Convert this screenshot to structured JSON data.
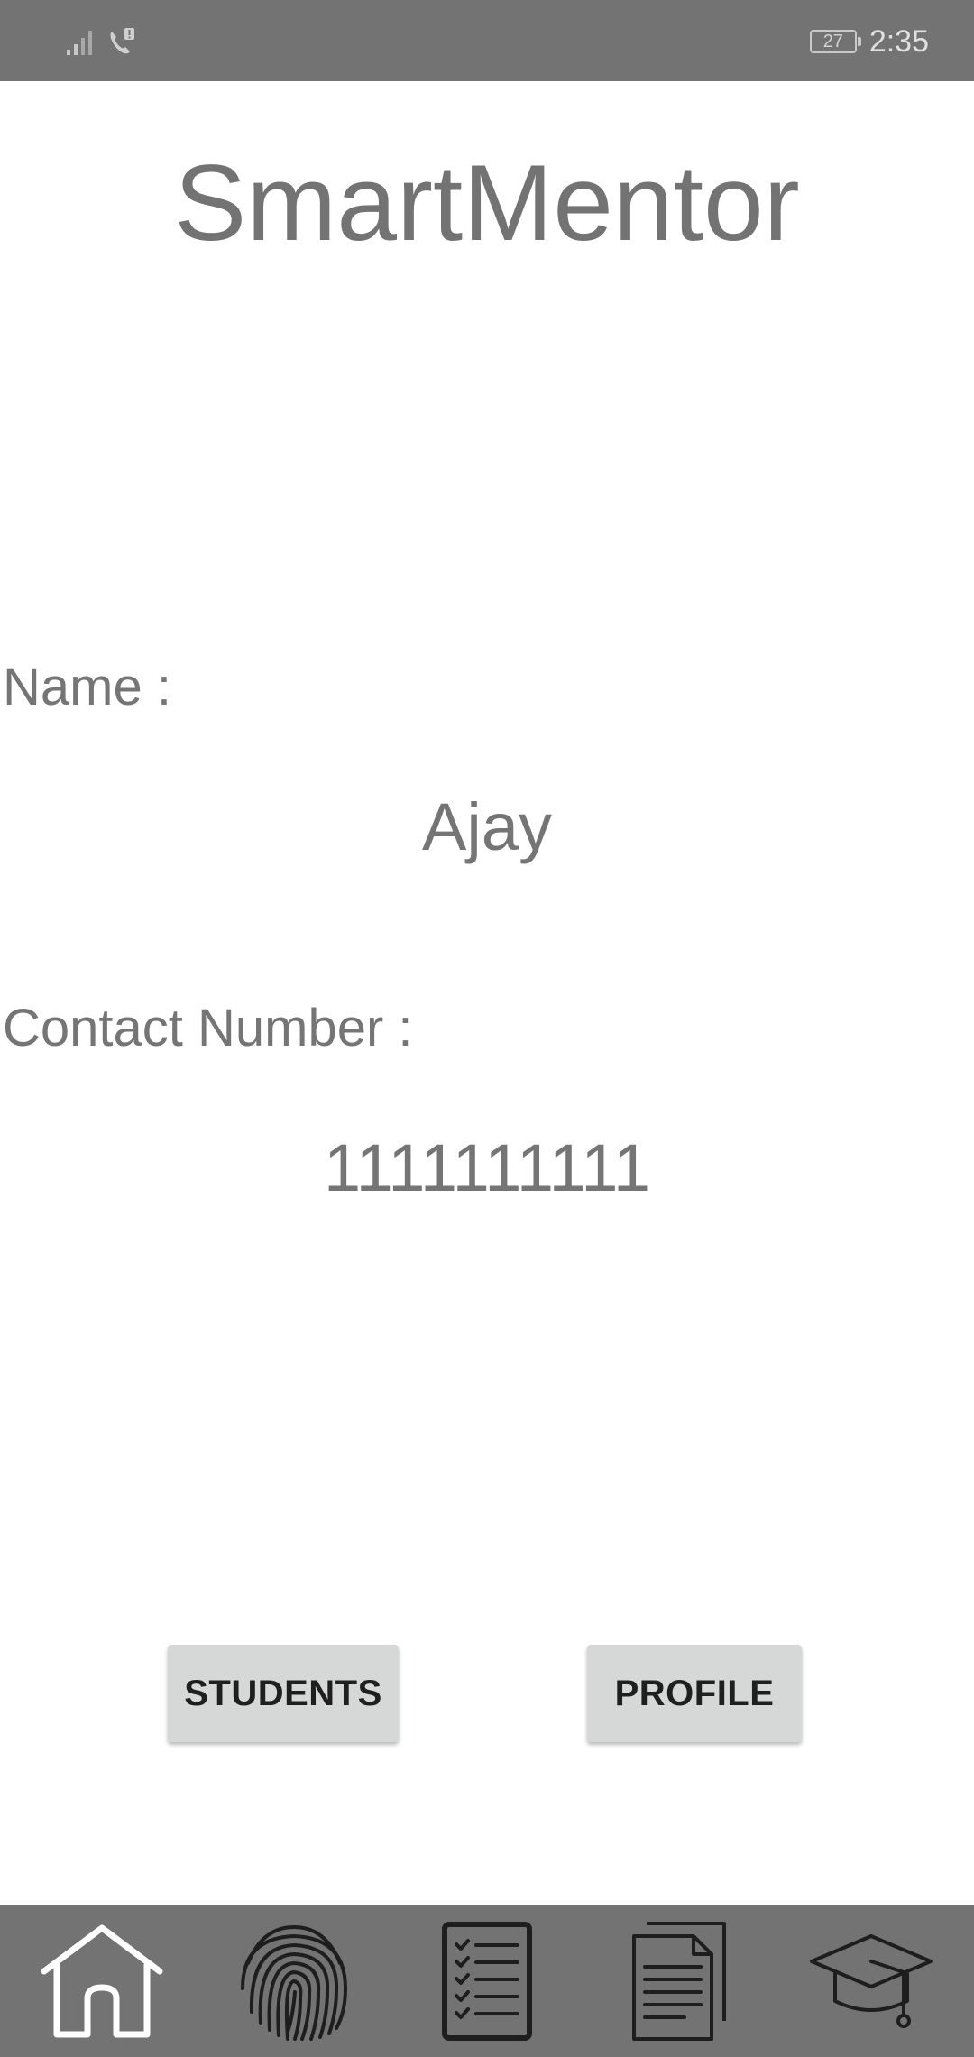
{
  "status_bar": {
    "battery_level": "27",
    "time": "2:35",
    "icons": [
      "signal-icon",
      "call-icon",
      "battery-icon"
    ]
  },
  "app": {
    "title": "SmartMentor"
  },
  "profile": {
    "name_label": "Name :",
    "name_value": "Ajay",
    "contact_label": "Contact Number :",
    "contact_value": "1111111111"
  },
  "buttons": {
    "students": "STUDENTS",
    "profile": "PROFILE"
  },
  "bottom_nav": {
    "items": [
      {
        "icon": "home-icon"
      },
      {
        "icon": "fingerprint-icon"
      },
      {
        "icon": "checklist-icon"
      },
      {
        "icon": "document-icon"
      },
      {
        "icon": "graduation-cap-icon"
      }
    ]
  },
  "colors": {
    "bar_background": "#737373",
    "text": "#757575",
    "button_background": "#d6d7d7"
  }
}
